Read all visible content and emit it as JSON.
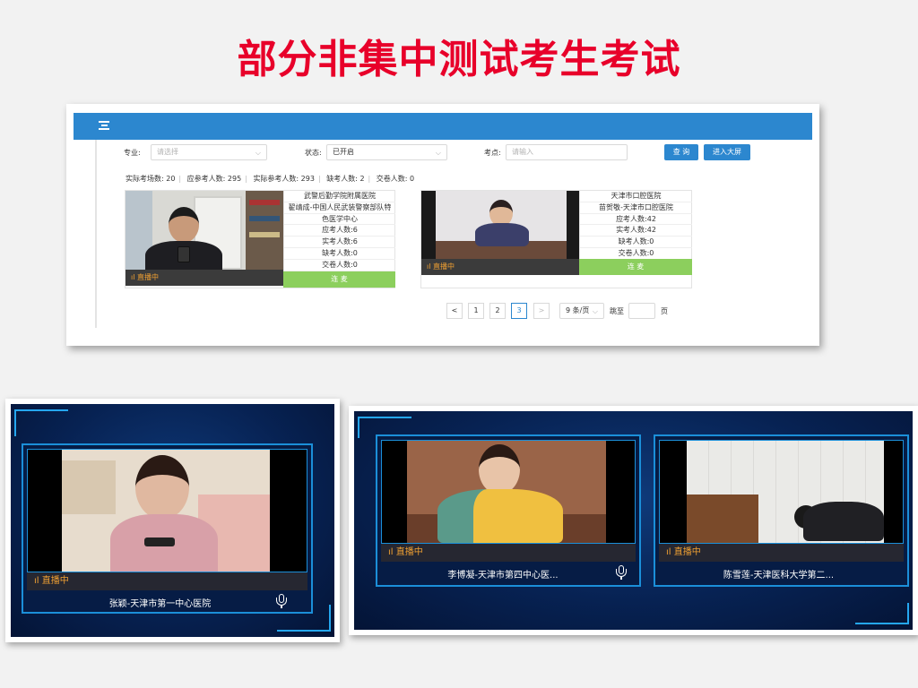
{
  "slide_title": "部分非集中测试考生考试",
  "filters": {
    "major_label": "专业:",
    "major_placeholder": "请选择",
    "status_label": "状态:",
    "status_value": "已开启",
    "site_label": "考点:",
    "site_placeholder": "请输入",
    "query_button": "查 询",
    "bigscreen_button": "进入大屏"
  },
  "stats": [
    "实际考场数: 20",
    "应参考人数: 295",
    "实际参考人数: 293",
    "缺考人数: 2",
    "交卷人数: 0"
  ],
  "cards": [
    {
      "live_label": "直播中",
      "lines": [
        "武警后勤学院附属医院",
        "翟靖成-中国人民武装警察部队特",
        "色医学中心",
        "应考人数:6",
        "实考人数:6",
        "缺考人数:0",
        "交卷人数:0"
      ],
      "button": "连 麦"
    },
    {
      "live_label": "直播中",
      "lines": [
        "天津市口腔医院",
        "苗贺敬-天津市口腔医院",
        "应考人数:42",
        "实考人数:42",
        "缺考人数:0",
        "交卷人数:0"
      ],
      "button": "连 麦"
    }
  ],
  "pagination": {
    "prev": "<",
    "pages": [
      "1",
      "2",
      "3"
    ],
    "active_page": "3",
    "next": ">",
    "page_size": "9 条/页",
    "goto_label": "跳至",
    "page_suffix": "页"
  },
  "big_screen": [
    {
      "live_label": "直播中",
      "name": "张颖-天津市第一中心医院"
    },
    {
      "live_label": "直播中",
      "name": "李博凝-天津市第四中心医..."
    },
    {
      "live_label": "直播中",
      "name": "陈雪莲-天津医科大学第二..."
    }
  ],
  "colors": {
    "title_red": "#e8002a",
    "header_blue": "#2c87cf",
    "live_orange": "#f0a032",
    "lianmai_green": "#8ccf5d",
    "tile_border": "#1b8fd9"
  }
}
